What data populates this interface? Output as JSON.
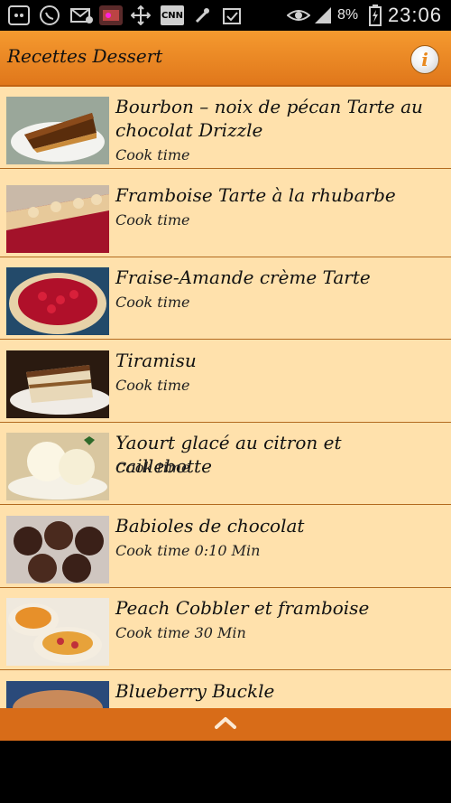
{
  "status_bar": {
    "battery_text": "8%",
    "time": "23:06",
    "icons": [
      "bbm-icon",
      "whatsapp-icon",
      "sms-icon",
      "photo-thumb-icon",
      "move-icon",
      "cnn-icon",
      "usb-icon",
      "clipboard-check-icon",
      "eye-icon",
      "signal-icon",
      "battery-icon"
    ]
  },
  "app_bar": {
    "title": "Recettes Dessert",
    "info_label": "i"
  },
  "recipes": [
    {
      "title": "Bourbon – noix de pécan Tarte au chocolat Drizzle",
      "cook": "Cook time"
    },
    {
      "title": "Framboise Tarte à la rhubarbe",
      "cook": "Cook time"
    },
    {
      "title": "Fraise-Amande crème Tarte",
      "cook": "Cook time"
    },
    {
      "title": "Tiramisu",
      "cook": "Cook time"
    },
    {
      "title": "Yaourt glacé au citron et caillebotte",
      "cook": "Cook time"
    },
    {
      "title": "Babioles de chocolat",
      "cook": "Cook time 0:10 Min"
    },
    {
      "title": "Peach Cobbler et framboise",
      "cook": "Cook time 30 Min"
    },
    {
      "title": "Blueberry Buckle",
      "cook": ""
    }
  ],
  "colors": {
    "accent": "#f08a25",
    "list_bg": "#ffe1ac",
    "bottom_bar": "#d86c18"
  }
}
